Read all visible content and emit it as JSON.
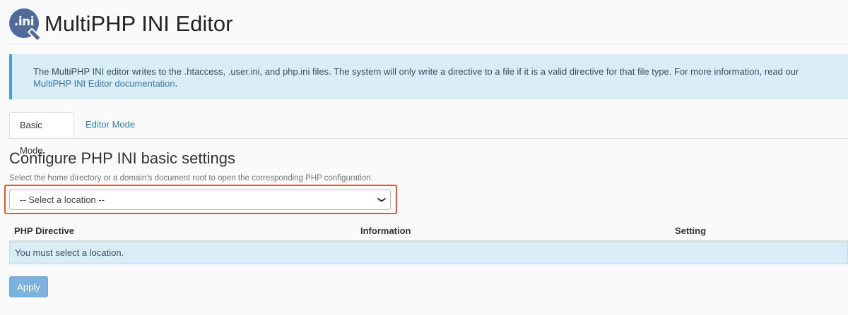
{
  "header": {
    "icon_text": ".ini",
    "title": "MultiPHP INI Editor"
  },
  "info": {
    "text": "The MultiPHP INI editor writes to the .htaccess, .user.ini, and php.ini files. The system will only write a directive to a file if it is a valid directive for that file type. For more information, read our ",
    "link_text": "MultiPHP INI Editor documentation",
    "suffix": "."
  },
  "tabs": [
    {
      "label": "Basic Mode",
      "active": true
    },
    {
      "label": "Editor Mode",
      "active": false
    }
  ],
  "section": {
    "title": "Configure PHP INI basic settings",
    "help": "Select the home directory or a domain’s document root to open the corresponding PHP configuration."
  },
  "location_select": {
    "selected": "-- Select a location --"
  },
  "table": {
    "columns": [
      "PHP Directive",
      "Information",
      "Setting"
    ],
    "empty_message": "You must select a location."
  },
  "apply_button": {
    "label": "Apply"
  },
  "colors": {
    "accent": "#3378b7",
    "info_bg": "#d9edf7",
    "highlight": "#e4582b",
    "button": "#7ab2dd"
  }
}
